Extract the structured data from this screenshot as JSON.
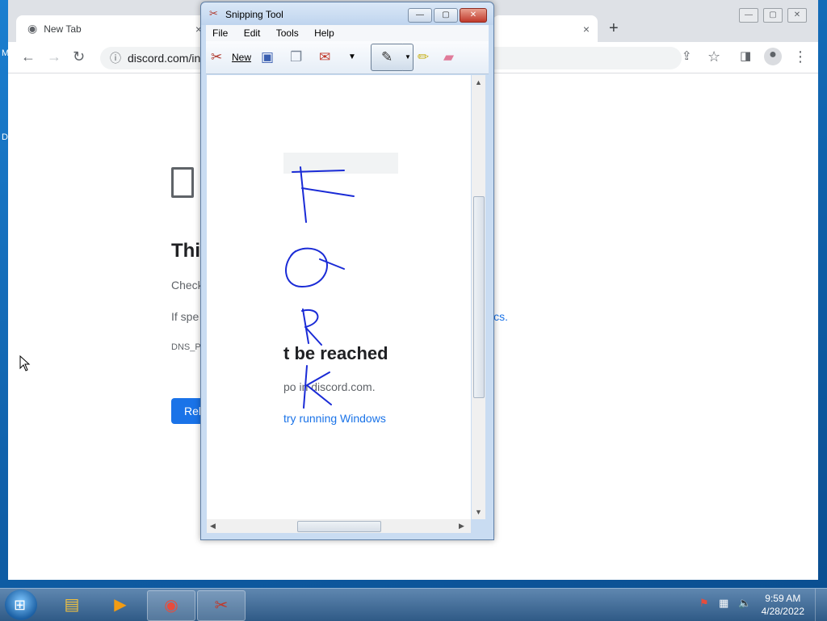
{
  "desktop": {
    "edge_labels": [
      "M",
      "D"
    ]
  },
  "chrome": {
    "tabs": [
      {
        "title": "New Tab",
        "close": "×"
      },
      {
        "title": "",
        "close": "×"
      }
    ],
    "new_tab": "+",
    "window_controls": [
      "—",
      "▢",
      "✕"
    ],
    "url": "discord.com/in",
    "error": {
      "title": "This",
      "title_tail": "t be reached",
      "line1": "Check",
      "line1_tail": "po in discord.com.",
      "line2": "If spe",
      "line2_tail": "try running Windows",
      "line2_link": "ics.",
      "code": "DNS_P",
      "reload": "Rel"
    }
  },
  "snipping_tool": {
    "title": "Snipping Tool",
    "menu": [
      "File",
      "Edit",
      "Tools",
      "Help"
    ],
    "new_label": "New",
    "drawing_letters": [
      "F",
      "O",
      "R",
      "K"
    ],
    "pen_color": "#1a2bd6"
  },
  "taskbar": {
    "time": "9:59 AM",
    "date": "4/28/2022"
  }
}
